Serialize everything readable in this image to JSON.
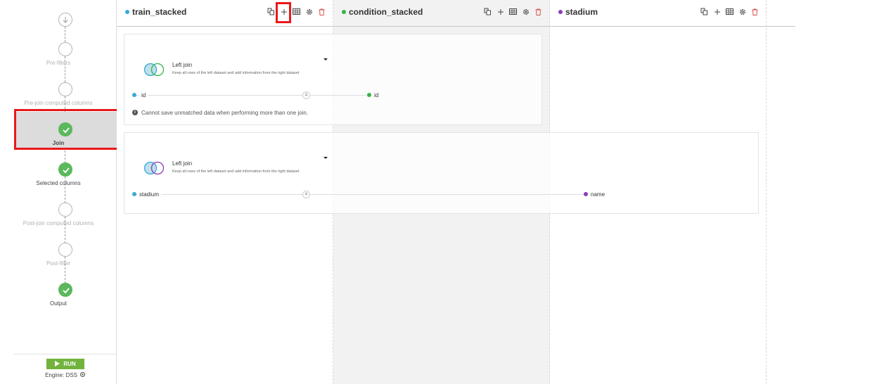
{
  "sidebar": {
    "steps": [
      {
        "label": "Pre-filters",
        "state": "pending"
      },
      {
        "label": "Pre-join computed columns",
        "state": "pending"
      },
      {
        "label": "Join",
        "state": "done"
      },
      {
        "label": "Selected columns",
        "state": "done"
      },
      {
        "label": "Post-join computed columns",
        "state": "pending"
      },
      {
        "label": "Post-filter",
        "state": "pending"
      },
      {
        "label": "Output",
        "state": "done"
      }
    ],
    "run_label": "RUN",
    "engine_label": "Engine: DSS"
  },
  "columns": [
    {
      "name": "train_stacked",
      "color": "#3aa9d6"
    },
    {
      "name": "condition_stacked",
      "color": "#3bb34a"
    },
    {
      "name": "stadium",
      "color": "#8a3fb5"
    }
  ],
  "tool_icons": [
    "datasets-icon",
    "add-icon",
    "table-icon",
    "settings-icon",
    "delete-icon"
  ],
  "joins": [
    {
      "type": "Left join",
      "description": "Keep all rows of the left dataset and add information from the right dataset",
      "left_key": "id",
      "operator": "=",
      "right_key": "id",
      "left_color": "#3aa9d6",
      "right_color": "#3bb34a",
      "warning": "Cannot save unmatched data when performing more than one join."
    },
    {
      "type": "Left join",
      "description": "Keep all rows of the left dataset and add information from the right dataset",
      "left_key": "stadium",
      "operator": "=",
      "right_key": "name",
      "left_color": "#3aa9d6",
      "right_color": "#8a3fb5"
    }
  ],
  "colors": {
    "accent_green": "#5cb85c",
    "run_green": "#72b33e",
    "highlight_red": "#e8191b",
    "delete_red": "#d9534f"
  }
}
